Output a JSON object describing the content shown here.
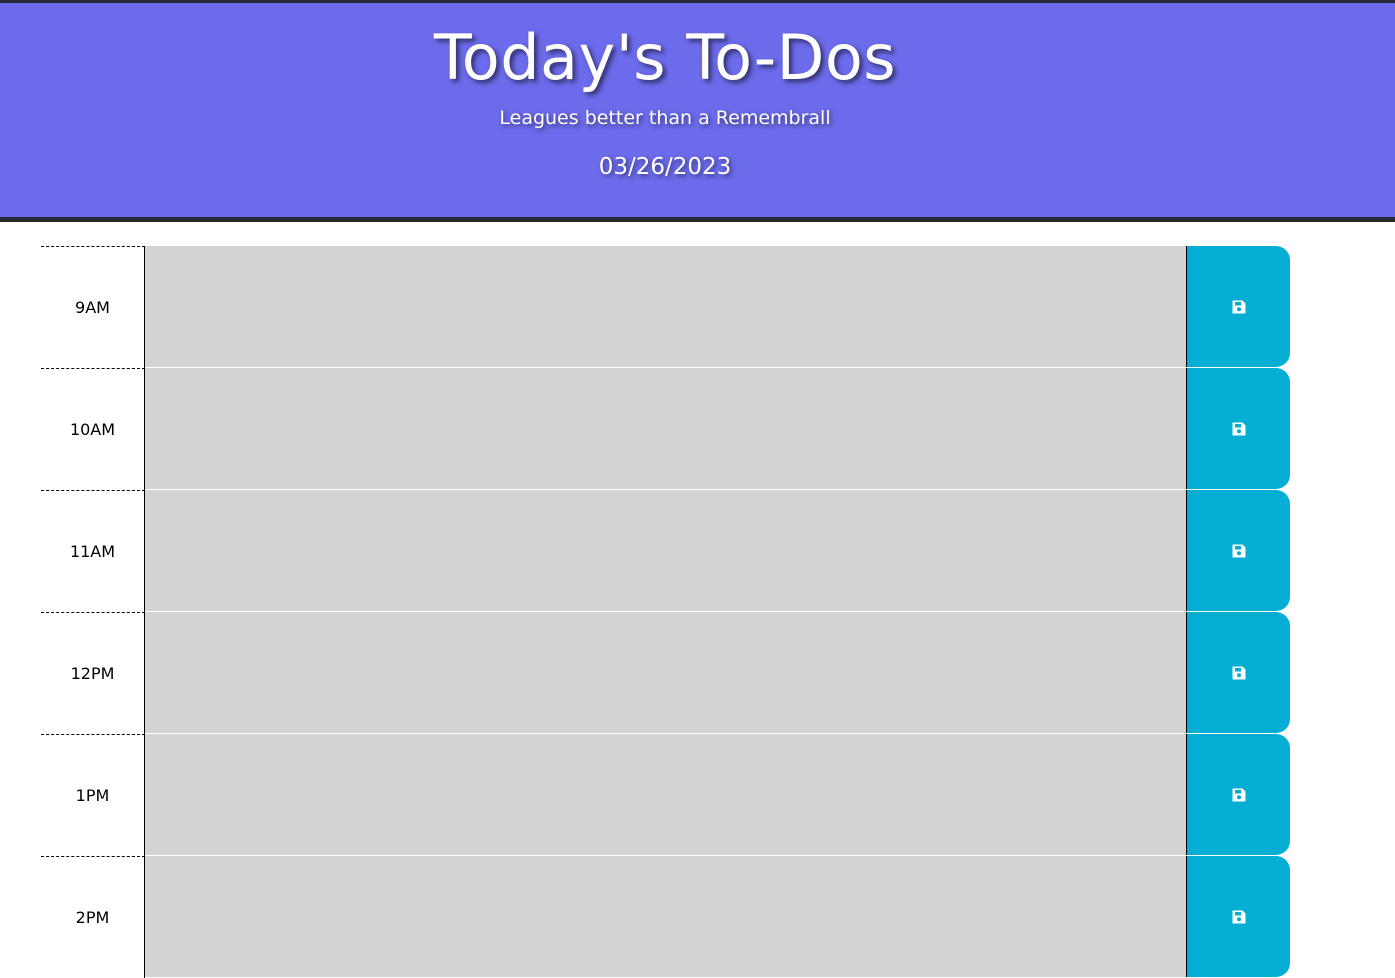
{
  "header": {
    "title": "Today's To-Dos",
    "subtitle": "Leagues better than a Remembrall",
    "date": "03/26/2023",
    "background_color": "#6b6beb"
  },
  "schedule": {
    "save_icon": "floppy-disk-icon",
    "save_button_color": "#06aed5",
    "rows": [
      {
        "hour": "9AM",
        "text": ""
      },
      {
        "hour": "10AM",
        "text": ""
      },
      {
        "hour": "11AM",
        "text": ""
      },
      {
        "hour": "12PM",
        "text": ""
      },
      {
        "hour": "1PM",
        "text": ""
      },
      {
        "hour": "2PM",
        "text": ""
      }
    ]
  }
}
